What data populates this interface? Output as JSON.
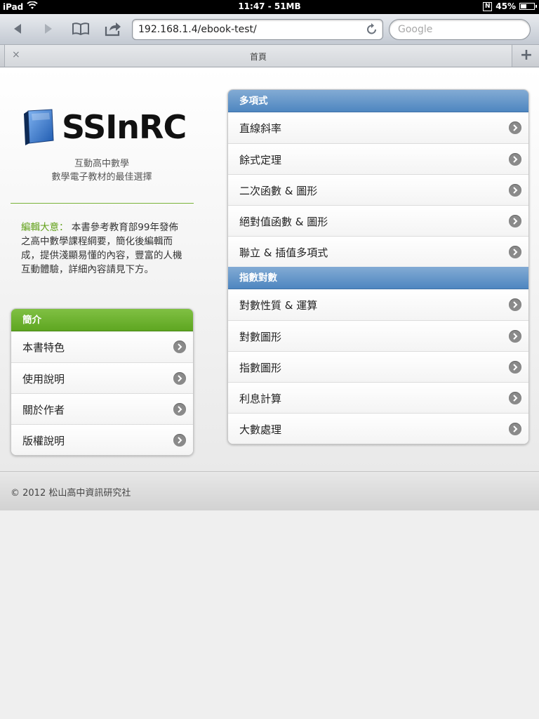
{
  "status_bar": {
    "device": "iPad",
    "time": "11:47 - 51MB",
    "battery": "45%",
    "battery_level": 0.45,
    "badge": "N"
  },
  "browser": {
    "url": "192.168.1.4/ebook-test/",
    "search_placeholder": "Google",
    "tab_title": "首頁",
    "new_tab_label": "+",
    "close_tab_label": "×"
  },
  "hero": {
    "brand": "SSInRC",
    "tagline_1": "互動高中數學",
    "tagline_2": "數學電子教材的最佳選擇"
  },
  "intro": {
    "lead": "編輯大意：",
    "body": " 本書參考教育部99年發佈之高中數學課程綱要，簡化後編輯而成，提供淺顯易懂的內容，豐富的人機互動體驗，詳細內容請見下方。"
  },
  "left_list": {
    "header": "簡介",
    "items": [
      "本書特色",
      "使用說明",
      "關於作者",
      "版權說明"
    ]
  },
  "right_list": {
    "section1": {
      "header": "多項式",
      "items": [
        "直線斜率",
        "餘式定理",
        "二次函數 & 圖形",
        "絕對值函數 & 圖形",
        "聯立 & 插值多項式"
      ]
    },
    "section2": {
      "header": "指數對數",
      "items": [
        "對數性質 & 運算",
        "對數圖形",
        "指數圖形",
        "利息計算",
        "大數處理"
      ]
    }
  },
  "footer": {
    "copyright": "© 2012 松山高中資訊研究社"
  },
  "colors": {
    "accent_green": "#5ea621",
    "accent_blue": "#4e86c0"
  }
}
